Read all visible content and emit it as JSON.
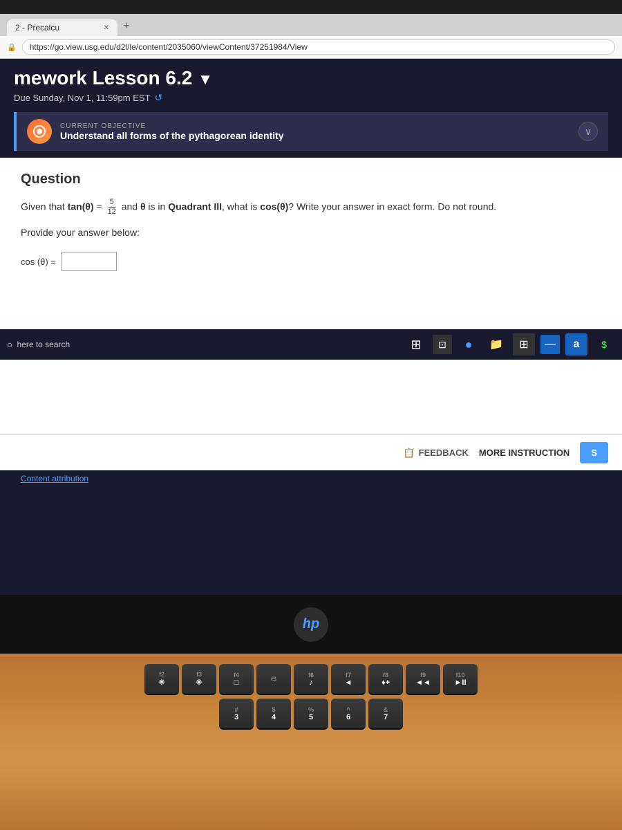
{
  "browser": {
    "tab_label": "2 - Precalcu",
    "url": "https://go.view.usg.edu/d2l/le/content/2035060/viewContent/37251984/View",
    "page_title": "mework Lesson 6.2",
    "due_date": "Due Sunday, Nov 1, 11:59pm EST",
    "objective_label": "CURRENT OBJECTIVE",
    "objective_title": "Understand all forms of the pythagorean identity",
    "question_heading": "Question",
    "question_text": "Given that tan(θ) = 5/12 and θ is in Quadrant III, what is cos(θ)? Write your answer in exact form. Do not round.",
    "answer_prompt": "Provide your answer below:",
    "cos_label": "cos (θ) =",
    "feedback_label": "FEEDBACK",
    "more_instruction_label": "MORE INSTRUCTION",
    "submit_label": "S",
    "content_attribution": "Content attribution",
    "search_placeholder": "here to search"
  },
  "taskbar": {
    "search_text": "here to search",
    "icons": [
      "⊞",
      "⚡",
      "●",
      "📁",
      "⊞",
      "—",
      "a",
      "$"
    ]
  },
  "keyboard": {
    "fn_row": [
      "f2 *",
      "f3 ✳",
      "f4 □",
      "f5",
      "f6 ♪",
      "f7 ◄",
      "f8 ♦",
      "f9 ◄◄",
      "f10 ►II"
    ],
    "number_row": [
      "# 3",
      "$ 4",
      "% 5",
      "^ 6",
      "& 7"
    ]
  }
}
